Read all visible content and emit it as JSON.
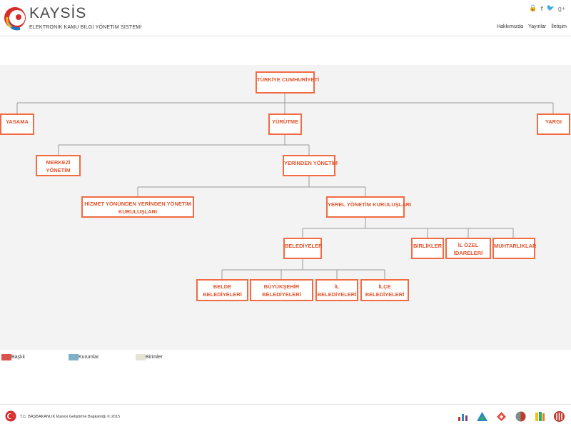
{
  "header": {
    "brand": "KAYSİS",
    "tagline": "ELEKTRONİK  KAMU BİLGİ YÖNETİM SİSTEMİ",
    "social": [
      "lock-icon",
      "facebook-icon",
      "twitter-icon",
      "google-plus-icon"
    ],
    "nav": [
      {
        "label": "Hakkımızda"
      },
      {
        "label": "Yayınlar"
      },
      {
        "label": "İletişim"
      }
    ]
  },
  "chart": {
    "root": "TÜRKİYE CUMHURİYETİ",
    "yasama": "YASAMA",
    "yurutme": "YÜRÜTME",
    "yargi": "YARGI",
    "merkezi": [
      "MERKEZİ",
      "YÖNETİM"
    ],
    "yerinden": "YERİNDEN YÖNETİM",
    "hizmet": [
      "HİZMET YÖNÜNDEN YERİNDEN YÖNETİM",
      "KURULUŞLARI"
    ],
    "yerel": "YEREL YÖNETİM KURULUŞLARI",
    "belediyeler": "BELEDİYELER",
    "birlikler": "BİRLİKLER",
    "il_ozel": [
      "İL ÖZEL",
      "İDARELERİ"
    ],
    "muhtarliklar": "MUHTARLIKLAR",
    "belde": [
      "BELDE",
      "BELEDİYELERİ"
    ],
    "buyuksehir": [
      "BÜYÜKŞEHİR",
      "BELEDİYELERİ"
    ],
    "il_bel": [
      "İL",
      "BELEDİYELERİ"
    ],
    "ilce_bel": [
      "İLÇE",
      "BELEDİYELERİ"
    ]
  },
  "legend": [
    {
      "label": "Başlık",
      "color": "#d9534f"
    },
    {
      "label": "Kurumlar",
      "color": "#7fb2c8"
    },
    {
      "label": "Birimler",
      "color": "#e5e3d3"
    }
  ],
  "footer": {
    "copyright": "T.C. BAŞBAKANLIK İdareyi Geliştirme Başkanlığı © 2015",
    "partners": [
      "partner-logo-1",
      "partner-logo-2",
      "partner-logo-3",
      "partner-logo-4",
      "partner-logo-5",
      "partner-logo-6"
    ]
  },
  "colors": {
    "accent": "#f26b43",
    "node_text": "#e2542c",
    "chart_bg": "#f3f3f3"
  }
}
